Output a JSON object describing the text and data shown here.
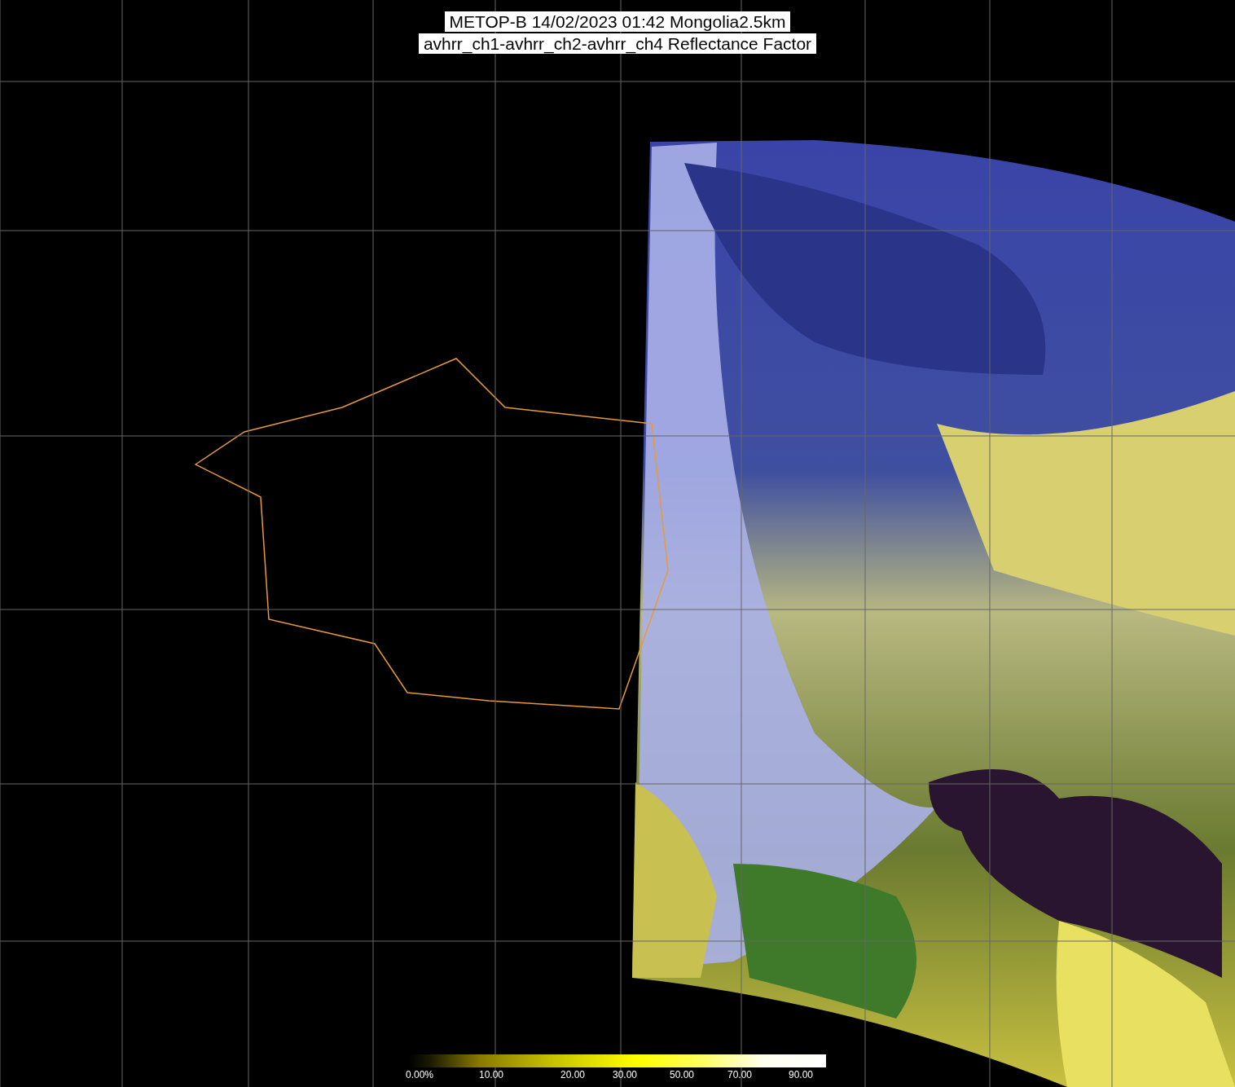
{
  "title_lines": [
    "METOP-B 14/02/2023 01:42 Mongolia2.5km",
    "avhrr_ch1-avhrr_ch2-avhrr_ch4 Reflectance Factor"
  ],
  "colorbar": {
    "labels": [
      "0.00%",
      "10.00",
      "20.00",
      "30.00",
      "50.00",
      "70.00",
      "90.00"
    ]
  }
}
